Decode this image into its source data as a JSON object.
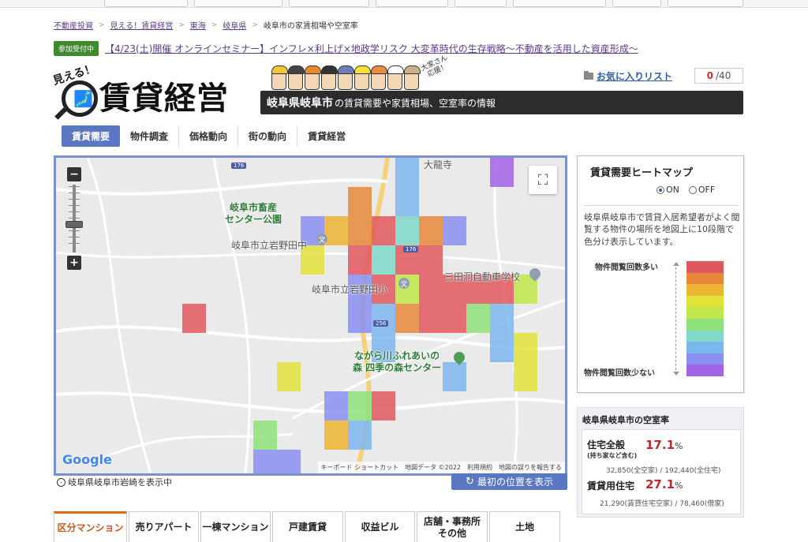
{
  "breadcrumb": {
    "items": [
      "不動産投資",
      "見える！賃貸経営",
      "東海",
      "岐阜県"
    ],
    "current": "岐阜市の家賃相場や空室率"
  },
  "notice": {
    "badge": "参加受付中",
    "text": "【4/23(土)開催 オンラインセミナー】インフレ×利上げ×地政学リスク 大変革時代の生存戦略〜不動産を活用した資産形成〜"
  },
  "logo": {
    "small": "見える！",
    "main": "賃貸経営",
    "support": "大家さん応援！"
  },
  "banner": {
    "place": "岐阜県岐阜市",
    "rest": "の賃貸需要や家賃相場、空室率の情報"
  },
  "favorites": {
    "label": "お気に入りリスト",
    "count": "0",
    "total": "/40"
  },
  "tabs": [
    "賃貸需要",
    "物件調査",
    "価格動向",
    "街の動向",
    "賃貸経営"
  ],
  "map": {
    "pois": {
      "park": "岐阜市畜産\nセンター公園",
      "school1": "岐阜市立岩野田中",
      "school2": "岐阜市立岩野田小",
      "driving": "三田洞自動車学校",
      "forest": "ながら川ふれあいの\n森 四季の森センター",
      "temple": "大龍寺"
    },
    "roads": [
      "176",
      "176",
      "256"
    ],
    "school_glyph": "文",
    "zoom_in": "+",
    "zoom_out": "−",
    "fullscreen_glyph": "⛶",
    "google": "Google",
    "attribution": [
      "キーボード ショートカット",
      "地図データ ©2022",
      "利用規約",
      "地図の誤りを報告する"
    ]
  },
  "map_location": "岐阜県岐阜市岩崎を表示中",
  "reset_button": "最初の位置を表示",
  "heatmap": {
    "title": "賃貸需要ヒートマップ",
    "on": "ON",
    "off": "OFF",
    "description": "岐阜県岐阜市で賃貸入居希望者がよく閲覧する物件の場所を地図上に10段階で色分け表示しています。",
    "label_high": "物件閲覧回数多い",
    "label_low": "物件閲覧回数少ない",
    "scale_colors": [
      "#e0585f",
      "#e9883a",
      "#ecb532",
      "#e2e23b",
      "#bfe64a",
      "#8ee27a",
      "#7fd8c8",
      "#7cb6ef",
      "#8a8ff0",
      "#a363e6"
    ]
  },
  "vacancy": {
    "title": "岐阜県岐阜市の空室率",
    "housing_label": "住宅全般",
    "housing_sub": "(持ち家など含む)",
    "housing_pct": "17.1",
    "housing_detail": "32,850(全空家) / 192,440(全住宅)",
    "rental_label": "賃貸用住宅",
    "rental_pct": "27.1",
    "rental_detail": "21,290(賃貸住宅空家) / 78,460(借家)",
    "unit": "%"
  },
  "property_types": [
    "区分マンション",
    "売りアパート",
    "一棟マンション",
    "戸建賃貸",
    "収益ビル",
    "店舗・事務所\nその他",
    "土地"
  ]
}
